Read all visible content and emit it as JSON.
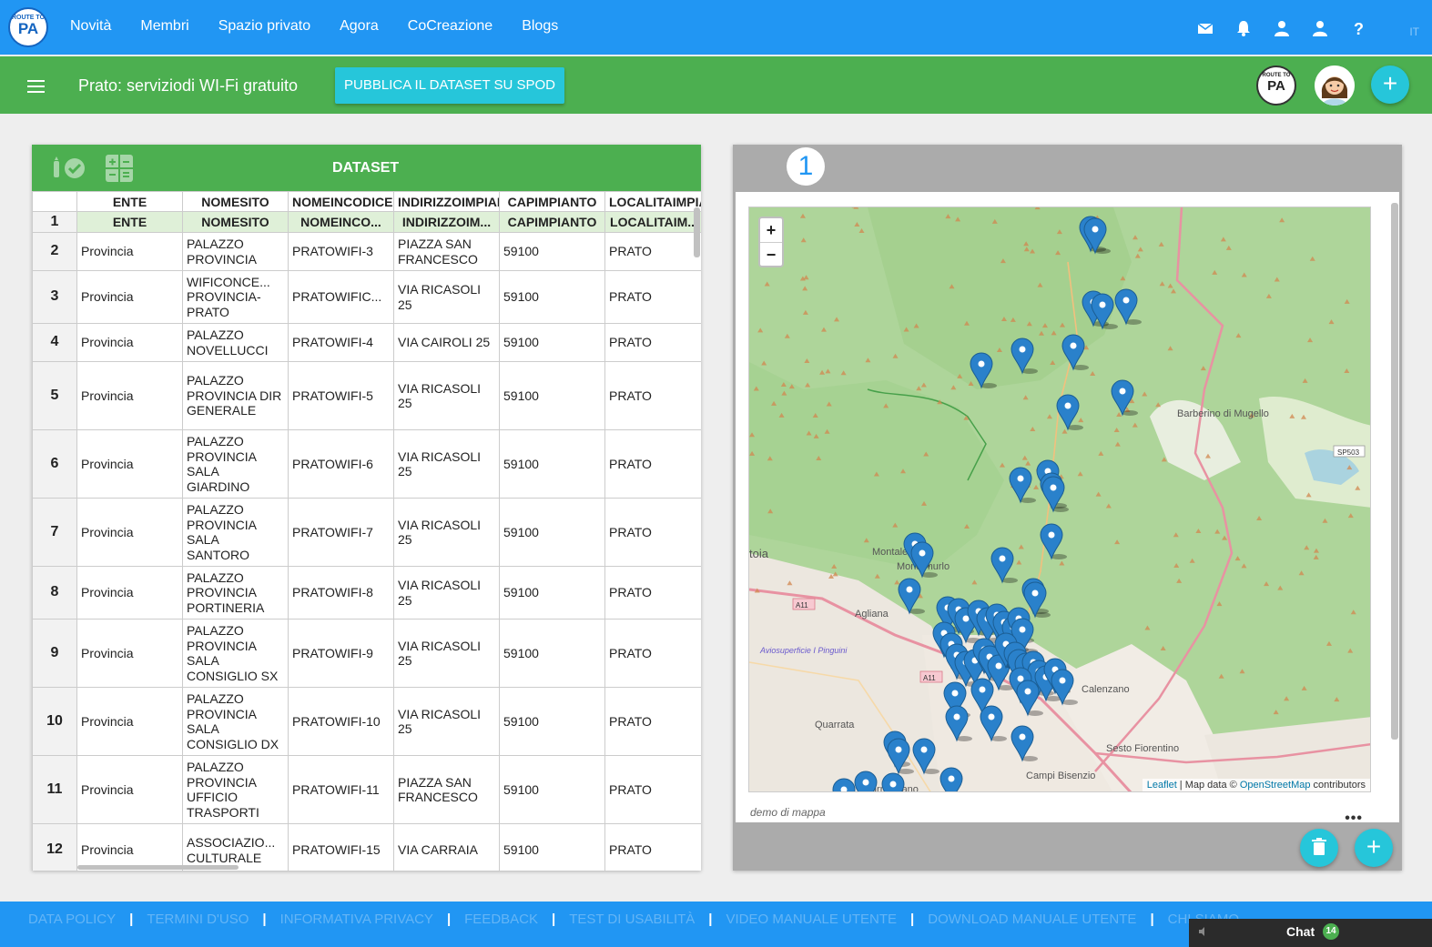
{
  "app": {
    "logo_top": "ROUTE TO",
    "logo_main": "PA",
    "nav": [
      "Novità",
      "Membri",
      "Spazio privato",
      "Agora",
      "CoCreazione",
      "Blogs"
    ],
    "lang": "IT",
    "icons": [
      "mail-icon",
      "bell-icon",
      "user-icon",
      "user-icon",
      "help-icon"
    ],
    "accent": "#2196f3",
    "green": "#4caf50",
    "teal": "#26c6da"
  },
  "header": {
    "title": "Prato: serviziodi WI-Fi gratuito",
    "publish_label": "PUBBLICA IL DATASET SU SPOD",
    "add_label": "+"
  },
  "dataset": {
    "title": "DATASET",
    "columns": [
      "ENTE",
      "NOMESITO",
      "NOMEINCODICE",
      "INDIRIZZOIMPIANTO",
      "CAPIMPIANTO",
      "LOCALITAIMPIA"
    ],
    "row1": [
      "1",
      "ENTE",
      "NOMESITO",
      "NOMEINCO...",
      "INDIRIZZOIM...",
      "CAPIMPIANTO",
      "LOCALITAIM..."
    ],
    "rows": [
      [
        "2",
        "Provincia",
        "PALAZZO PROVINCIA",
        "PRATOWIFI-3",
        "PIAZZA SAN FRANCESCO",
        "59100",
        "PRATO"
      ],
      [
        "3",
        "Provincia",
        "WIFICONCE... PROVINCIA-PRATO",
        "PRATOWIFIC...",
        "VIA RICASOLI 25",
        "59100",
        "PRATO"
      ],
      [
        "4",
        "Provincia",
        "PALAZZO NOVELLUCCI",
        "PRATOWIFI-4",
        "VIA CAIROLI 25",
        "59100",
        "PRATO"
      ],
      [
        "5",
        "Provincia",
        "PALAZZO PROVINCIA DIR GENERALE",
        "PRATOWIFI-5",
        "VIA RICASOLI 25",
        "59100",
        "PRATO"
      ],
      [
        "6",
        "Provincia",
        "PALAZZO PROVINCIA SALA GIARDINO",
        "PRATOWIFI-6",
        "VIA RICASOLI 25",
        "59100",
        "PRATO"
      ],
      [
        "7",
        "Provincia",
        "PALAZZO PROVINCIA SALA SANTORO",
        "PRATOWIFI-7",
        "VIA RICASOLI 25",
        "59100",
        "PRATO"
      ],
      [
        "8",
        "Provincia",
        "PALAZZO PROVINCIA PORTINERIA",
        "PRATOWIFI-8",
        "VIA RICASOLI 25",
        "59100",
        "PRATO"
      ],
      [
        "9",
        "Provincia",
        "PALAZZO PROVINCIA SALA CONSIGLIO SX",
        "PRATOWIFI-9",
        "VIA RICASOLI 25",
        "59100",
        "PRATO"
      ],
      [
        "10",
        "Provincia",
        "PALAZZO PROVINCIA SALA CONSIGLIO DX",
        "PRATOWIFI-10",
        "VIA RICASOLI 25",
        "59100",
        "PRATO"
      ],
      [
        "11",
        "Provincia",
        "PALAZZO PROVINCIA UFFICIO TRASPORTI",
        "PRATOWIFI-11",
        "PIAZZA SAN FRANCESCO",
        "59100",
        "PRATO"
      ],
      [
        "12",
        "Provincia",
        "ASSOCIAZIO... CULTURALE",
        "PRATOWIFI-15",
        "VIA CARRAIA",
        "59100",
        "PRATO"
      ]
    ]
  },
  "map": {
    "number": "1",
    "zoom_in": "+",
    "zoom_out": "−",
    "places": [
      "Barberino di Mugello",
      "Montale",
      "Montemurlo",
      "Agliana",
      "Aviosuperficie I Pinguini",
      "Quarrata",
      "Calenzano",
      "Sesto Fiorentino",
      "Campi Bisenzio",
      "Carmignano",
      "toia"
    ],
    "roads": [
      "A11",
      "A11",
      "SP503"
    ],
    "attribution_leaflet": "Leaflet",
    "attribution_mid": " | Map data © ",
    "attribution_osm": "OpenStreetMap",
    "attribution_end": " contributors",
    "caption": "demo di mappa",
    "more": "•••",
    "marker_color": "#2a81cb"
  },
  "footer": {
    "links": [
      "DATA POLICY",
      "TERMINI D'USO",
      "INFORMATIVA PRIVACY",
      "FEEDBACK",
      "TEST DI USABILITÀ",
      "VIDEO MANUALE UTENTE",
      "DOWNLOAD MANUALE UTENTE",
      "CHI SIAMO"
    ],
    "separator": "|",
    "chat_label": "Chat",
    "chat_count": "14"
  }
}
